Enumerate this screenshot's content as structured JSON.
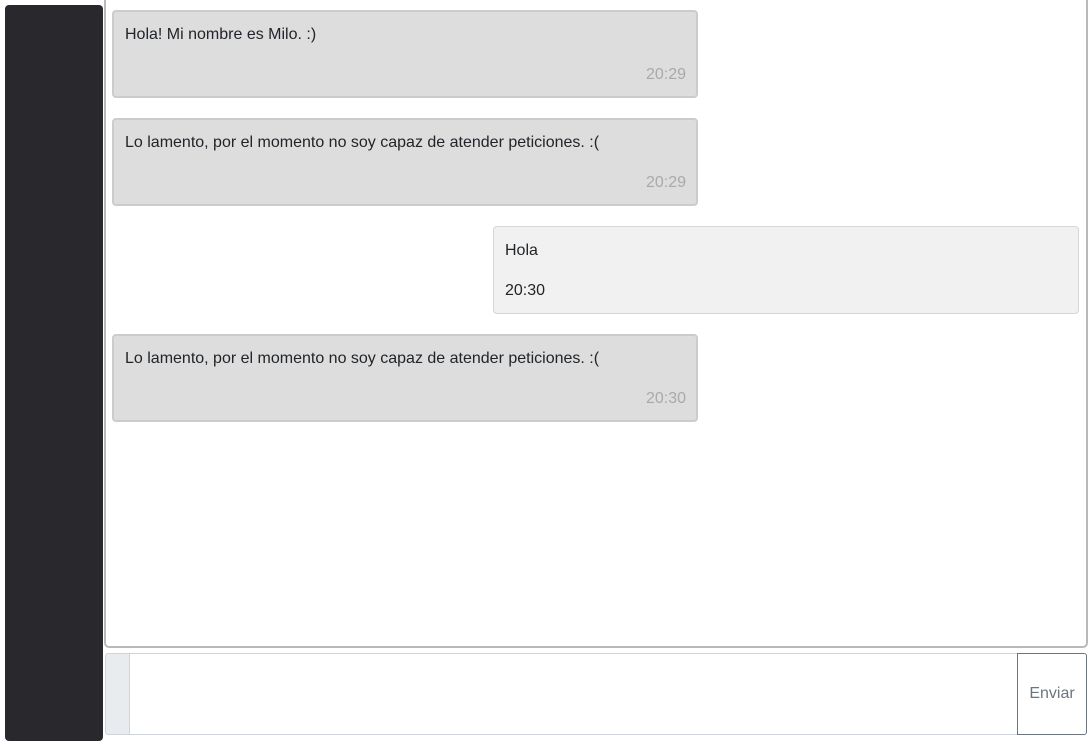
{
  "messages": [
    {
      "sender": "bot",
      "text": "Hola! Mi nombre es Milo. :)",
      "time": "20:29"
    },
    {
      "sender": "bot",
      "text": "Lo lamento, por el momento no soy capaz de atender peticiones. :(",
      "time": "20:29"
    },
    {
      "sender": "user",
      "text": "Hola",
      "time": "20:30"
    },
    {
      "sender": "bot",
      "text": "Lo lamento, por el momento no soy capaz de atender peticiones. :(",
      "time": "20:30"
    }
  ],
  "composer": {
    "value": "",
    "placeholder": "",
    "send_label": "Enviar"
  },
  "colors": {
    "sidebar": "#28282d",
    "bot_bubble": "#dddddd",
    "user_bubble": "#f1f1f1",
    "timestamp_muted": "#a9a9a9"
  }
}
